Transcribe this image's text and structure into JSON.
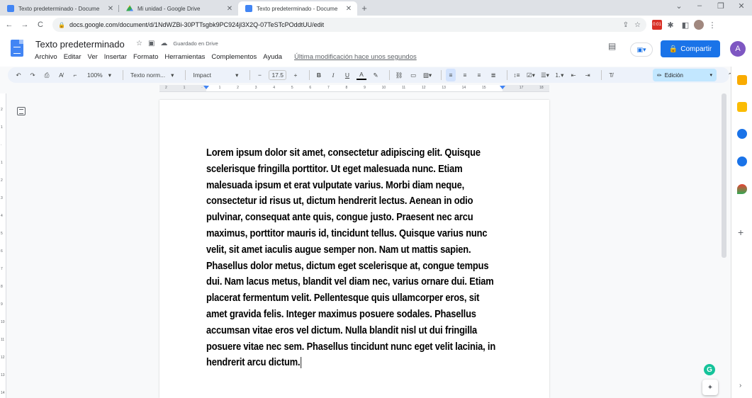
{
  "browser": {
    "tabs": [
      {
        "title": "Texto predeterminado - Docume",
        "favicon": "docs-icon",
        "active": false
      },
      {
        "title": "Mi unidad - Google Drive",
        "favicon": "drive-icon",
        "active": false
      },
      {
        "title": "Texto predeterminado - Docume",
        "favicon": "docs-icon",
        "active": true
      }
    ],
    "new_tab": "+",
    "url": "docs.google.com/document/d/1NdWZBi-30PTTsgbk9PC924jl3X2Q-07TeSTcPOddtUU/edit",
    "rec_badge": "0:01"
  },
  "docs": {
    "title": "Texto predeterminado",
    "saved_status": "Guardado en Drive",
    "menu": [
      "Archivo",
      "Editar",
      "Ver",
      "Insertar",
      "Formato",
      "Herramientas",
      "Complementos",
      "Ayuda"
    ],
    "last_modified": "Última modificación hace unos segundos",
    "share_label": "Compartir",
    "account_initial": "A"
  },
  "toolbar": {
    "zoom": "100%",
    "style": "Texto norm...",
    "font": "Impact",
    "font_size": "17.5",
    "bold": "B",
    "italic": "I",
    "underline": "U",
    "text_color": "A",
    "mode": "Edición"
  },
  "ruler": {
    "ticks": [
      "2",
      "1",
      "",
      "1",
      "2",
      "3",
      "4",
      "5",
      "6",
      "7",
      "8",
      "9",
      "10",
      "11",
      "12",
      "13",
      "14",
      "15",
      "",
      "17",
      "18"
    ],
    "vticks": [
      "2",
      "1",
      "",
      "1",
      "2",
      "3",
      "4",
      "5",
      "6",
      "7",
      "8",
      "9",
      "10",
      "11",
      "12",
      "13",
      "14"
    ]
  },
  "document": {
    "body": "Lorem ipsum dolor sit amet, consectetur adipiscing elit. Quisque scelerisque fringilla porttitor. Ut eget malesuada nunc. Etiam malesuada ipsum et erat vulputate varius. Morbi diam neque, consectetur id risus ut, dictum hendrerit lectus. Aenean in odio pulvinar, consequat ante quis, congue justo. Praesent nec arcu maximus, porttitor mauris id, tincidunt tellus. Quisque varius nunc velit, sit amet iaculis augue semper non. Nam ut mattis sapien. Phasellus dolor metus, dictum eget scelerisque at, congue tempus dui. Nam lacus metus, blandit vel diam nec, varius ornare dui. Etiam placerat fermentum velit. Pellentesque quis ullamcorper eros, sit amet gravida felis. Integer maximus posuere sodales. Phasellus accumsan vitae eros vel dictum. Nulla blandit nisl ut dui fringilla posuere vitae nec sem. Phasellus tincidunt nunc eget velit lacinia, in hendrerit arcu dictum."
  },
  "colors": {
    "accent": "#1a73e8",
    "toolbar_bg": "#edf2fa",
    "grammarly": "#15c39a"
  }
}
